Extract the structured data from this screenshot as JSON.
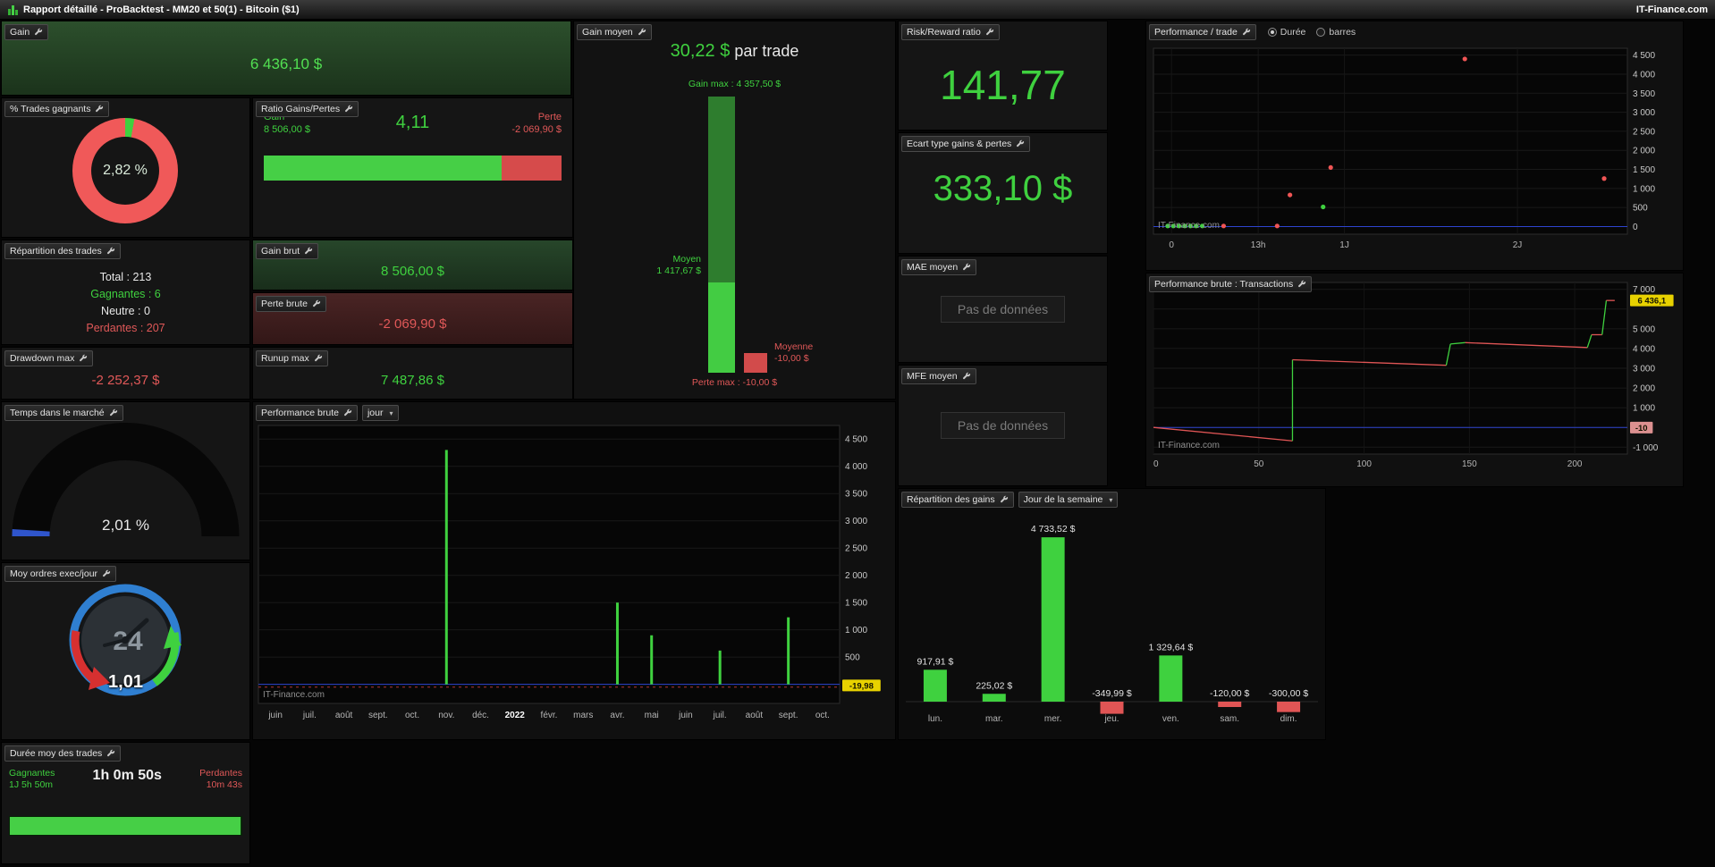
{
  "titlebar": {
    "title": "Rapport détaillé - ProBacktest - MM20 et 50(1) - Bitcoin ($1)",
    "brand": "IT-Finance.com"
  },
  "ui": {
    "caret": "▾"
  },
  "colors": {
    "green": "#3fd13f",
    "red": "#e05555",
    "blue_line": "#2e44cf",
    "badge_yellow": "#e8d200",
    "badge_pink": "#dc9090"
  },
  "panels": {
    "gain": {
      "title": "Gain",
      "value": "6 436,10 $"
    },
    "win_rate": {
      "title": "% Trades gagnants",
      "value": "2,82 %",
      "pct": 2.82
    },
    "ratio": {
      "title": "Ratio Gains/Pertes",
      "value": "4,11",
      "gain_label": "Gain",
      "gain_value": "8 506,00 $",
      "loss_label": "Perte",
      "loss_value": "-2 069,90 $",
      "gain_frac": 0.8
    },
    "trade_split": {
      "title": "Répartition des trades",
      "rows": [
        {
          "text": "Total : 213"
        },
        {
          "text": "Gagnantes : 6"
        },
        {
          "text": "Neutre : 0"
        },
        {
          "text": "Perdantes : 207"
        }
      ]
    },
    "gross_gain": {
      "title": "Gain brut",
      "value": "8 506,00 $"
    },
    "gross_loss": {
      "title": "Perte brute",
      "value": "-2 069,90 $"
    },
    "drawdown": {
      "title": "Drawdown max",
      "value": "-2 252,37 $"
    },
    "runup": {
      "title": "Runup max",
      "value": "7 487,86 $"
    },
    "time_in_market": {
      "title": "Temps dans le marché",
      "value": "2,01 %",
      "pct": 2.01
    },
    "orders_per_day": {
      "title": "Moy ordres exec/jour",
      "value": "1,01",
      "dial": "24"
    },
    "avg_duration": {
      "title": "Durée moy des trades",
      "win_label": "Gagnantes",
      "win_value": "1J 5h 50m",
      "mid_value": "1h 0m 50s",
      "loss_label": "Perdantes",
      "loss_value": "10m 43s",
      "win_frac": 0.995
    },
    "avg_gain": {
      "title": "Gain moyen",
      "headline": "30,22 $",
      "headline_suffix": " par trade",
      "max_label": "Gain max : 4 357,50 $",
      "mean_label": "Moyen",
      "mean_value": "1 417,67 $",
      "avg_loss_label": "Moyenne",
      "avg_loss_value": "-10,00 $",
      "min_label": "Perte max : -10,00 $",
      "gain_max": 4357.5,
      "mean": 1417.67
    },
    "risk_reward": {
      "title": "Risk/Reward ratio",
      "value": "141,77"
    },
    "std_dev": {
      "title": "Ecart type gains & pertes",
      "value": "333,10 $"
    },
    "mae": {
      "title": "MAE moyen",
      "value": "Pas de données"
    },
    "mfe": {
      "title": "MFE moyen",
      "value": "Pas de données"
    }
  },
  "chart_data": [
    {
      "id": "monthly",
      "type": "bar",
      "title": "Performance brute",
      "dropdown": "jour",
      "categories": [
        "juin",
        "juil.",
        "août",
        "sept.",
        "oct.",
        "nov.",
        "déc.",
        "2022",
        "févr.",
        "mars",
        "avr.",
        "mai",
        "juin",
        "juil.",
        "août",
        "sept.",
        "oct."
      ],
      "bold_category": "2022",
      "values": [
        0,
        0,
        0,
        0,
        0,
        4300,
        0,
        0,
        0,
        0,
        1500,
        900,
        0,
        620,
        0,
        1230,
        0
      ],
      "ylim": [
        -350,
        4750
      ],
      "ytick_values": [
        500,
        1000,
        1500,
        2000,
        2500,
        3000,
        3500,
        4000,
        4500
      ],
      "yticks": [
        "500",
        "1 000",
        "1 500",
        "2 000",
        "2 500",
        "3 000",
        "3 500",
        "4 000",
        "4 500"
      ],
      "badge": {
        "text": "-19,98",
        "value": -20,
        "color": "yellow"
      },
      "neg_dash_line": -50,
      "zero_line": true,
      "watermark": "IT-Finance.com",
      "legend_position": "none",
      "grid": true
    },
    {
      "id": "per_trade",
      "type": "scatter",
      "title": "Performance / trade",
      "radios": [
        {
          "label": "Durée",
          "checked": true
        },
        {
          "label": "barres",
          "checked": false
        }
      ],
      "xticks": [
        {
          "label": "0",
          "frac": 0.038
        },
        {
          "label": "13h",
          "frac": 0.221
        },
        {
          "label": "1J",
          "frac": 0.403
        },
        {
          "label": "2J",
          "frac": 0.768
        }
      ],
      "ylim": [
        -200,
        4680
      ],
      "ytick_values": [
        0,
        500,
        1000,
        1500,
        2000,
        2500,
        3000,
        3500,
        4000,
        4500
      ],
      "yticks": [
        "0",
        "500",
        "1 000",
        "1 500",
        "2 000",
        "2 500",
        "3 000",
        "3 500",
        "4 000",
        "4 500"
      ],
      "points": [
        {
          "x": 0.03,
          "y": 15,
          "c": "green"
        },
        {
          "x": 0.042,
          "y": 15,
          "c": "green"
        },
        {
          "x": 0.054,
          "y": 15,
          "c": "green"
        },
        {
          "x": 0.066,
          "y": 15,
          "c": "green"
        },
        {
          "x": 0.078,
          "y": 15,
          "c": "green"
        },
        {
          "x": 0.09,
          "y": 15,
          "c": "green"
        },
        {
          "x": 0.103,
          "y": 15,
          "c": "green"
        },
        {
          "x": 0.148,
          "y": 15,
          "c": "red"
        },
        {
          "x": 0.261,
          "y": 15,
          "c": "red"
        },
        {
          "x": 0.288,
          "y": 830,
          "c": "red"
        },
        {
          "x": 0.358,
          "y": 515,
          "c": "green"
        },
        {
          "x": 0.374,
          "y": 1550,
          "c": "red"
        },
        {
          "x": 0.657,
          "y": 4400,
          "c": "red"
        },
        {
          "x": 0.951,
          "y": 1260,
          "c": "red"
        }
      ],
      "zero_line": true,
      "watermark": "IT-Finance.com",
      "grid": true
    },
    {
      "id": "transactions",
      "type": "line",
      "title": "Performance brute : Transactions",
      "xlim": [
        0,
        225
      ],
      "xticks": [
        0,
        50,
        100,
        150,
        200
      ],
      "ylim": [
        -1350,
        7350
      ],
      "ytick_values": [
        7000,
        6000,
        5000,
        4000,
        3000,
        2000,
        1000,
        0,
        -1000
      ],
      "yticks": [
        "7 000",
        "",
        "5 000",
        "4 000",
        "3 000",
        "2 000",
        "1 000",
        "",
        "-1 000"
      ],
      "badges": [
        {
          "text": "6 436,1",
          "value": 6436,
          "color": "yellow"
        },
        {
          "text": "-10",
          "value": -10,
          "color": "pink"
        }
      ],
      "points": [
        [
          0,
          0
        ],
        [
          66,
          -680
        ],
        [
          66,
          3430
        ],
        [
          139,
          3150
        ],
        [
          141,
          4230
        ],
        [
          148,
          4300
        ],
        [
          206,
          4050
        ],
        [
          208,
          4700
        ],
        [
          213,
          4700
        ],
        [
          215,
          6436
        ],
        [
          219,
          6436
        ]
      ],
      "zero_line": true,
      "watermark": "IT-Finance.com",
      "grid": true
    },
    {
      "id": "weekday",
      "type": "bar",
      "title": "Répartition des gains",
      "dropdown": "Jour de la semaine",
      "categories": [
        "lun.",
        "mar.",
        "mer.",
        "jeu.",
        "ven.",
        "sam.",
        "dim."
      ],
      "values": [
        917.91,
        225.02,
        4733.52,
        -349.99,
        1329.64,
        -120.0,
        -300.0
      ],
      "labels": [
        "917,91 $",
        "225,02 $",
        "4 733,52 $",
        "-349,99 $",
        "1 329,64 $",
        "-120,00 $",
        "-300,00 $"
      ],
      "ylim": [
        -900,
        5200
      ],
      "grid": false,
      "legend_position": "none"
    }
  ]
}
